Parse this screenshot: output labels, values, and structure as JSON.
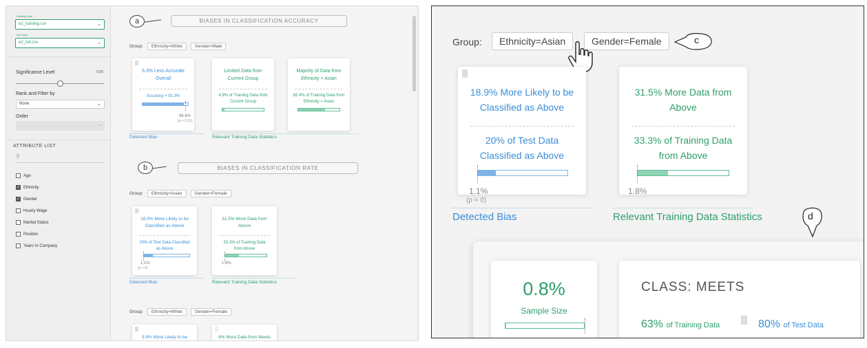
{
  "sidebar": {
    "training_date_label": "Training Date",
    "training_file": "e2_training.csv",
    "test_data_label": "Test Data",
    "test_file": "e2_full.csv",
    "significance_label": "Significance Level",
    "significance_value": "0.05",
    "rank_label": "Rank and Filter by",
    "rank_value": "None",
    "order_label": "Order",
    "attribute_list_label": "ATTRIBUTE LIST",
    "search_glyph": "⚲",
    "attributes": [
      {
        "name": "Age",
        "checked": false
      },
      {
        "name": "Ethnicity",
        "checked": true
      },
      {
        "name": "Gender",
        "checked": true
      },
      {
        "name": "Hourly Wage",
        "checked": false
      },
      {
        "name": "Marital Status",
        "checked": false
      },
      {
        "name": "Position",
        "checked": false
      },
      {
        "name": "Years In Company",
        "checked": false
      }
    ]
  },
  "main": {
    "group_label": "Group:",
    "section_a": {
      "marker": "a",
      "title": "BIASES IN CLASSIFICATION ACCURACY"
    },
    "section_b": {
      "marker": "b",
      "title": "BIASES IN CLASSIFICATION RATE"
    },
    "group1": {
      "chips": [
        "Ethnicity=White",
        "Gender=Male"
      ],
      "bias_card": {
        "title": "5.3% Less Accurate Overall",
        "detail": "Accuracy = 91.3%",
        "bar_value": 0.913,
        "ref_value": "96.6%",
        "p": "(p = 0.01)"
      },
      "stat_cards": [
        {
          "title": "Limited Data from Current Group",
          "detail": "4.9% of Training Data from Current Group",
          "bar_value": 0.049
        },
        {
          "title": "Majority of Data from Ethnicity = Asian",
          "detail": "65.4% of Training Data from Ethnicity = Asian",
          "bar_value": 0.654
        }
      ],
      "detected_label": "Detected Bias",
      "stats_label": "Relevant Training Data Statistics"
    },
    "group2": {
      "chips": [
        "Ethnicity=Asian",
        "Gender=Female"
      ],
      "bias_card": {
        "title": "18.9% More Likely to be Classified as Above",
        "detail": "20% of Test Data Classified as Above",
        "bar_value": 0.2,
        "ref_value": "1.1%",
        "p": "(p = 0)"
      },
      "stat_card": {
        "title": "31.5% More Data from Above",
        "detail": "33.3% of Training Data from Above",
        "bar_value": 0.333,
        "ref_value": "1.8%"
      },
      "detected_label": "Detected Bias",
      "stats_label": "Relevant Training Data Statistics"
    },
    "group3": {
      "chips": [
        "Ethnicity=White",
        "Gender=Female"
      ],
      "bias_card_title": "9.9% More Likely to be Classified as Meets",
      "stat_card_title": "6% More Data from Meets"
    }
  },
  "zoom": {
    "group_label": "Group:",
    "chips": [
      "Ethnicity=Asian",
      "Gender=Female"
    ],
    "marker_c": "c",
    "marker_d": "d",
    "bias_title": "18.9% More Likely to be Classified as Above",
    "bias_detail": "20% of Test Data Classified as Above",
    "bias_bar_value": 0.2,
    "bias_ref": "1.1%",
    "bias_p": "(p = 0)",
    "stat_title": "31.5% More Data from Above",
    "stat_detail": "33.3% of Training Data from Above",
    "stat_bar_value": 0.333,
    "stat_ref": "1.8%",
    "detected_label": "Detected Bias",
    "stats_label": "Relevant Training Data Statistics",
    "sample_value": "0.8%",
    "sample_label": "Sample Size",
    "sample_bar_value": 0.008,
    "class_title": "CLASS: MEETS",
    "train_pct": "63%",
    "train_label": "of Training Data",
    "test_pct": "80%",
    "test_label": "of Test Data"
  },
  "colors": {
    "green": "#2e9e6b",
    "blue": "#3a8dd8",
    "bar_blue": "#7fb3e6",
    "bar_green": "#8fd4b4"
  }
}
